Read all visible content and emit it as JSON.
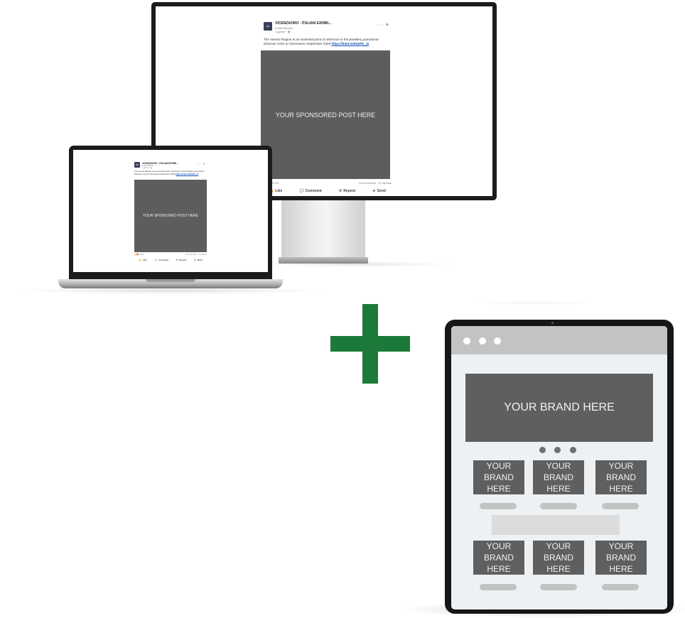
{
  "post": {
    "account_name": "VICENZAORO - ITALIAN EXHIBI...",
    "followers": "6.188 follower",
    "age": "1 giorno",
    "menu_icon": "ellipsis-icon",
    "close_label": "×",
    "menu_label": "···",
    "text": "The Veneto Region is an essential point of reference in the jewellery panorama! Discover more at Vicenzaoro September 2025",
    "link": "https://lnkd.in/dSeP8_Jz",
    "image_label": "YOUR SPONSORED POST HERE",
    "reactions": "1.024",
    "comments_reposts": "10 comments · 17 reposts",
    "actions": {
      "like": "Like",
      "comment": "Comment",
      "repost": "Repost",
      "send": "Send"
    }
  },
  "tablet": {
    "hero_label": "YOUR BRAND HERE",
    "tiles": [
      "YOUR BRAND HERE",
      "YOUR BRAND HERE",
      "YOUR BRAND HERE",
      "YOUR BRAND HERE",
      "YOUR BRAND HERE",
      "YOUR BRAND HERE"
    ]
  },
  "colors": {
    "plus": "#1b7a3a",
    "placeholder": "#5f5f5f",
    "tablet_screen": "#edf1f4",
    "link": "#0a4fb4"
  }
}
